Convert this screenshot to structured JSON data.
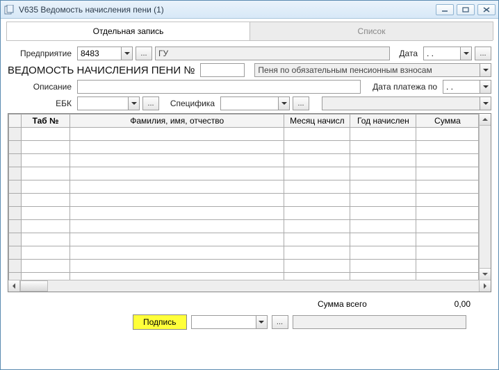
{
  "window": {
    "title": "V635 Ведомость начисления пени (1)"
  },
  "tabs": {
    "single": "Отдельная запись",
    "list": "Список"
  },
  "labels": {
    "enterprise": "Предприятие",
    "date": "Дата",
    "heading": "ВЕДОМОСТЬ НАЧИСЛЕНИЯ ПЕНИ №",
    "description": "Описание",
    "payment_date_to": "Дата платежа по",
    "ebk": "ЕБК",
    "specifika": "Специфика",
    "sum_total": "Сумма всего"
  },
  "fields": {
    "enterprise_code": "8483",
    "enterprise_name": "ГУ",
    "date": " .  .",
    "doc_number": "",
    "penalty_type": "Пеня по обязательным пенсионным взносам",
    "description": "",
    "payment_date_to": " .  .",
    "ebk": "",
    "specifika": "",
    "extra_combo": "",
    "sum_total": "0,00",
    "sign_combo": "",
    "sign_readonly": ""
  },
  "buttons": {
    "ellipsis": "...",
    "sign": "Подпись"
  },
  "table": {
    "columns": {
      "tab_no": "Таб №",
      "fio": "Фамилия, имя, отчество",
      "month": "Месяц начисл",
      "year": "Год начислен",
      "sum": "Сумма"
    },
    "row_count": 12
  }
}
